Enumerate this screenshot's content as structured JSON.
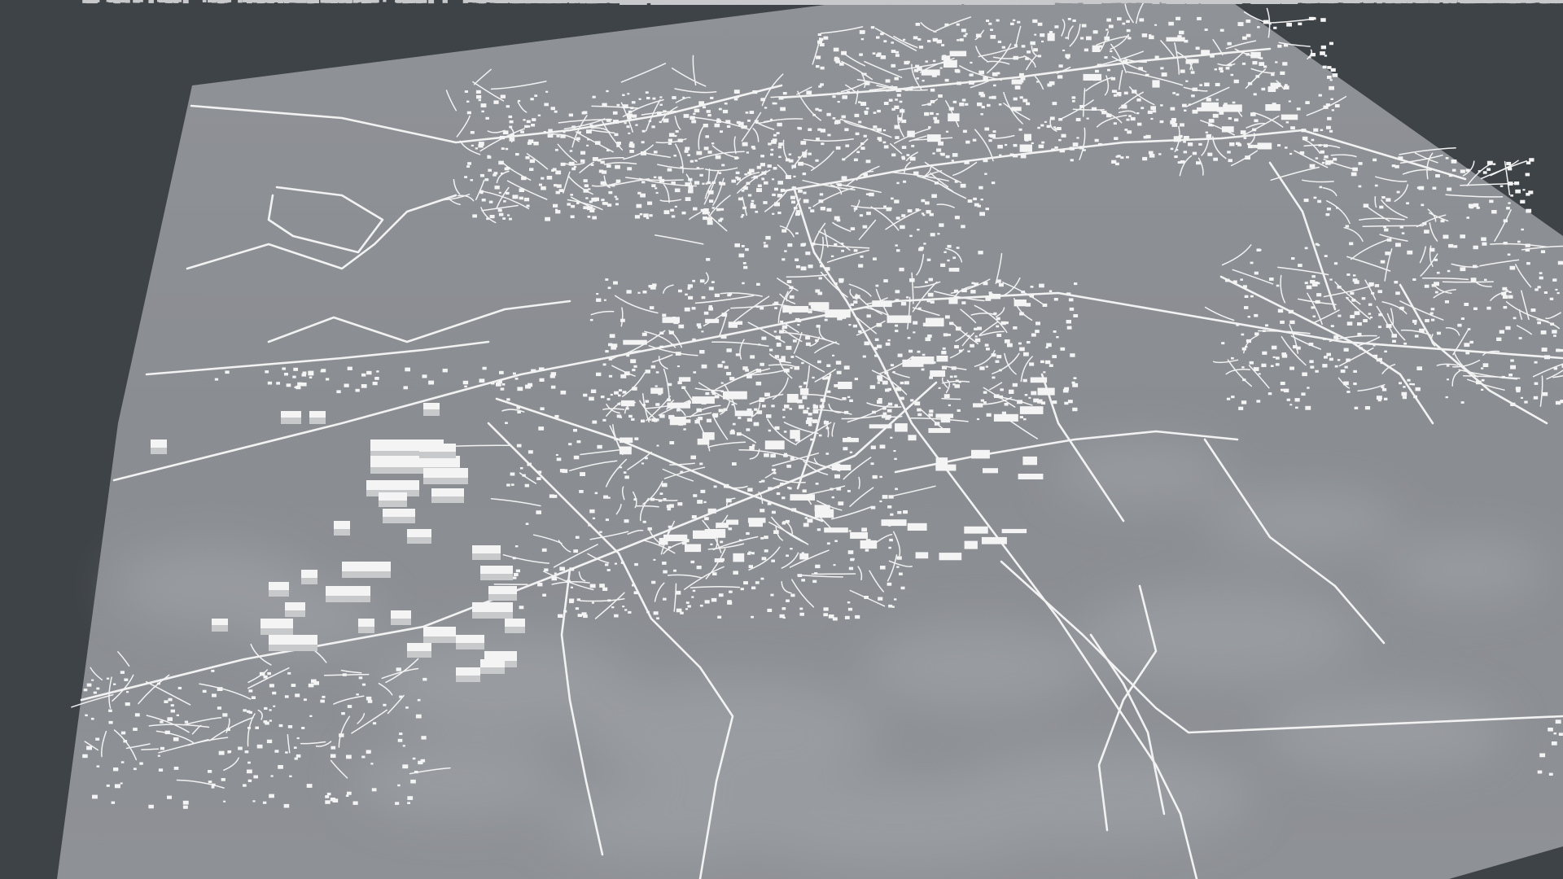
{
  "scene": {
    "type": "3d-city-map-render",
    "background_color": "#3e4347",
    "terrain_color": "#8c8f94",
    "terrain_highlight_color": "#a3a6aa",
    "road_color": "#f2f2f2",
    "building_color": "#f4f4f4",
    "building_shade_color": "#c8c9cb"
  }
}
